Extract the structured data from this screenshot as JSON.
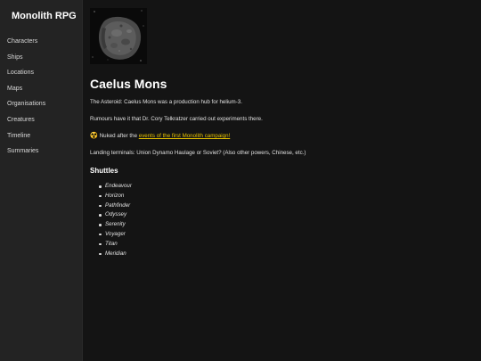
{
  "site": {
    "title": "Monolith RPG"
  },
  "nav": {
    "items": [
      "Characters",
      "Ships",
      "Locations",
      "Maps",
      "Organisations",
      "Creatures",
      "Timeline",
      "Summaries"
    ]
  },
  "page": {
    "title": "Caelus Mons",
    "intro": "The Asteroid: Caelus Mons was a production hub for helium-3.",
    "rumours": "Rumours have it that Dr. Cory Telkratzer carried out experiments there.",
    "nuked_prefix": "Nuked after the ",
    "nuked_link": "events of the first Monolith campaign!",
    "nuked_icon": "radioactive-icon",
    "landing": "Landing terminals: Union Dynamo Haulage or Soviet? (Also other powers, Chinese, etc.)",
    "shuttles_heading": "Shuttles",
    "shuttles": [
      "Endeavour",
      "Horizon",
      "Pathfinder",
      "Odyssey",
      "Serenity",
      "Voyager",
      "Titan",
      "Meridian"
    ]
  },
  "colors": {
    "link": "#e6c200",
    "sidebar_bg": "#232323",
    "main_bg": "#141414"
  }
}
